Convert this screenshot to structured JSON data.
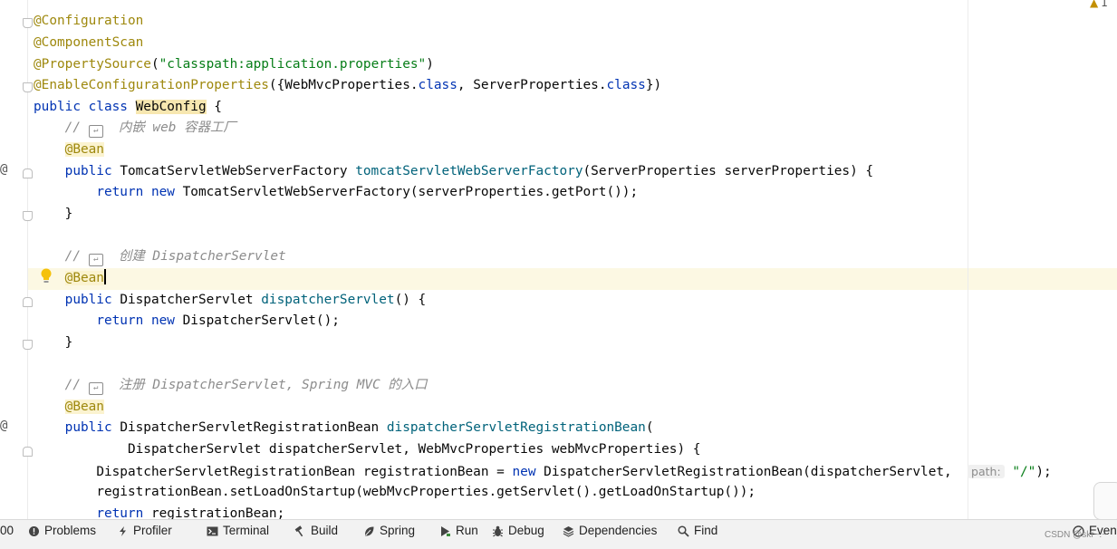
{
  "editor": {
    "code": {
      "l1": "@Configuration",
      "l2": "@ComponentScan",
      "l3_ann": "@PropertySource",
      "l3_open": "(",
      "l3_str": "\"classpath:application.properties\"",
      "l3_close": ")",
      "l4_ann": "@EnableConfigurationProperties",
      "l4_a": "({WebMvcProperties.",
      "l4_kw1": "class",
      "l4_b": ", ServerProperties.",
      "l4_kw2": "class",
      "l4_c": "})",
      "l5_kw": "public class ",
      "l5_cls": "WebConfig",
      "l5_end": " {",
      "l6_slashes": "//",
      "l6_text": "内嵌 web 容器工厂",
      "l7": "@Bean",
      "l8_kw": "public ",
      "l8_type": "TomcatServletWebServerFactory ",
      "l8_fn": "tomcatServletWebServerFactory",
      "l8_rest": "(ServerProperties serverProperties) {",
      "l9_kw": "return new ",
      "l9_rest": "TomcatServletWebServerFactory(serverProperties.getPort());",
      "l10": "}",
      "l12_slashes": "//",
      "l12_text": "创建 DispatcherServlet",
      "l13": "@Bean",
      "l14_kw": "public ",
      "l14_type": "DispatcherServlet ",
      "l14_fn": "dispatcherServlet",
      "l14_rest": "() {",
      "l15_kw": "return new ",
      "l15_rest": "DispatcherServlet();",
      "l16": "}",
      "l18_slashes": "//",
      "l18_text": "注册 DispatcherServlet, Spring MVC 的入口",
      "l19": "@Bean",
      "l20_kw": "public ",
      "l20_type": "DispatcherServletRegistrationBean ",
      "l20_fn": "dispatcherServletRegistrationBean",
      "l20_rest": "(",
      "l21": "DispatcherServlet dispatcherServlet, WebMvcProperties webMvcProperties) {",
      "l22_a": "DispatcherServletRegistrationBean registrationBean = ",
      "l22_kw": "new",
      "l22_b": " DispatcherServletRegistrationBean(dispatcherServlet, ",
      "l22_hint": "path:",
      "l22_str": "\"/\"",
      "l22_c": ");",
      "l23": "registrationBean.setLoadOnStartup(webMvcProperties.getServlet().getLoadOnStartup());",
      "l24_kw": "return ",
      "l24_rest": "registrationBean;"
    },
    "gutter_marker": "@",
    "warnings_count": "1"
  },
  "toolwindows": {
    "partial": "00",
    "problems": "Problems",
    "profiler": "Profiler",
    "terminal": "Terminal",
    "build": "Build",
    "spring": "Spring",
    "run": "Run",
    "debug": "Debug",
    "dependencies": "Dependencies",
    "find": "Find",
    "event_log": "Even"
  },
  "watermark": "CSDN @skr~.~",
  "colors": {
    "annotation": "#9e880d",
    "keyword": "#0033b3",
    "string": "#067d17",
    "method": "#00627a",
    "comment": "#8c8c8c",
    "current_line": "#fcf8e3"
  }
}
